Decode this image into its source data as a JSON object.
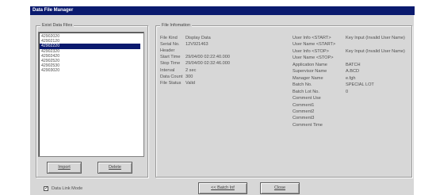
{
  "window": {
    "title": "Data File Manager"
  },
  "exist_files": {
    "label": "Exist Data Files",
    "items": [
      "42902020",
      "42902120",
      "42902220",
      "42902320",
      "42902420",
      "42902520",
      "42902530",
      "42903020"
    ],
    "selected_index": 2
  },
  "buttons": {
    "import": "Import",
    "delete": "Delete",
    "batch_inf": "<< Batch Inf",
    "close": "Close"
  },
  "file_info": {
    "label": "File Infomation",
    "left": [
      {
        "key": "File Kind",
        "value": "Display Data"
      },
      {
        "key": "Serial No.",
        "value": "12V921463"
      },
      {
        "key": "Header",
        "value": ""
      },
      {
        "key": "Start Time",
        "value": "29/04/00 02:22:40.000"
      },
      {
        "key": "Stop Time",
        "value": "29/04/00 02:32:46.000"
      },
      {
        "key": "Interval",
        "value": "2 sec"
      },
      {
        "key": "Data Count",
        "value": "300"
      },
      {
        "key": "File Status",
        "value": "Valid"
      }
    ],
    "right": [
      {
        "key": "User Info <START>",
        "value": "Key Input (Invalid User Name)"
      },
      {
        "key": "User Name <START>",
        "value": ""
      },
      {
        "key": "User Info <STOP>",
        "value": "Key Input (Invalid User Name)"
      },
      {
        "key": "User Name <STOP>",
        "value": ""
      },
      {
        "key": "Application Name",
        "value": "BATCH"
      },
      {
        "key": "Supervisor Name",
        "value": "A.BCD"
      },
      {
        "key": "Manager Name",
        "value": "e.fgh"
      },
      {
        "key": "Batch No.",
        "value": "SPECIAL LOT"
      },
      {
        "key": "Batch Lot No.",
        "value": "0"
      },
      {
        "key": "Comment Use",
        "value": ""
      },
      {
        "key": "Comment1",
        "value": ""
      },
      {
        "key": "Comment2",
        "value": ""
      },
      {
        "key": "Comment3",
        "value": ""
      },
      {
        "key": "Comment Time",
        "value": ""
      }
    ]
  },
  "data_link": {
    "label": "Data Link Mode",
    "checked": true
  }
}
